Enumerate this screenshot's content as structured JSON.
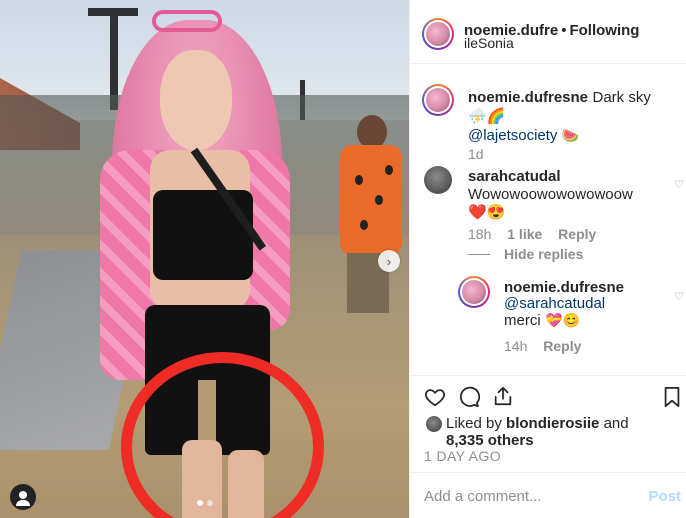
{
  "header": {
    "username": "noemie.dufre",
    "separator": "•",
    "follow_label": "Following",
    "location": "ileSonia"
  },
  "caption": {
    "username": "noemie.dufresne",
    "text": "Dark sky",
    "emoji1": "⛈️🌈",
    "mention": "@lajetsociety",
    "emoji2": "🍉",
    "time": "1d"
  },
  "comments": [
    {
      "username": "sarahcatudal",
      "text": "Wowowoowowowowoow",
      "emoji": "❤️😍",
      "time": "18h",
      "likes": "1 like",
      "reply_label": "Reply",
      "hide_replies": "Hide replies"
    }
  ],
  "reply": {
    "username": "noemie.dufresne",
    "mention": "@sarahcatudal",
    "text": "merci",
    "emoji": "💝😊",
    "time": "14h",
    "reply_label": "Reply"
  },
  "likes": {
    "prefix": "Liked by",
    "user": "blondierosiie",
    "and": "and",
    "count": "8,335 others"
  },
  "date_label": "1 DAY AGO",
  "comment_bar": {
    "placeholder": "Add a comment...",
    "post_label": "Post"
  },
  "colors": {
    "link": "#00376b",
    "post_disabled": "#b3dbff",
    "circle": "#ee2c25"
  }
}
